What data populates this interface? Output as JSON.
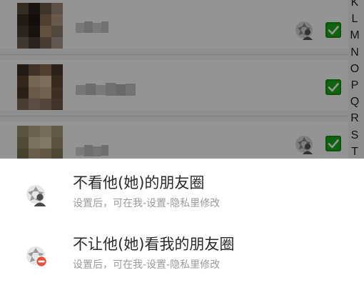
{
  "contact_list": {
    "contacts": [
      {
        "avatar": "blurred-avatar",
        "name": "",
        "moments_icon": true,
        "selected": true
      },
      {
        "avatar": "blurred-avatar",
        "name": "",
        "moments_icon": false,
        "selected": true
      },
      {
        "avatar": "blurred-avatar",
        "name": "",
        "moments_icon": true,
        "selected": true
      }
    ],
    "index_letters": [
      "K",
      "L",
      "M",
      "N",
      "O",
      "P",
      "Q",
      "R",
      "S",
      "T"
    ]
  },
  "action_sheet": {
    "options": [
      {
        "icon": "hide-moments-icon",
        "title": "不看他(她)的朋友圈",
        "subtitle": "设置后，可在我-设置-隐私里修改"
      },
      {
        "icon": "block-moments-icon",
        "title": "不让他(她)看我的朋友圈",
        "subtitle": "设置后，可在我-设置-隐私里修改"
      }
    ]
  },
  "colors": {
    "check_green": "#1aad19",
    "block_badge_red": "#e5533f",
    "title_text": "#2a2a2a",
    "subtitle_text": "#9a9a9a"
  }
}
